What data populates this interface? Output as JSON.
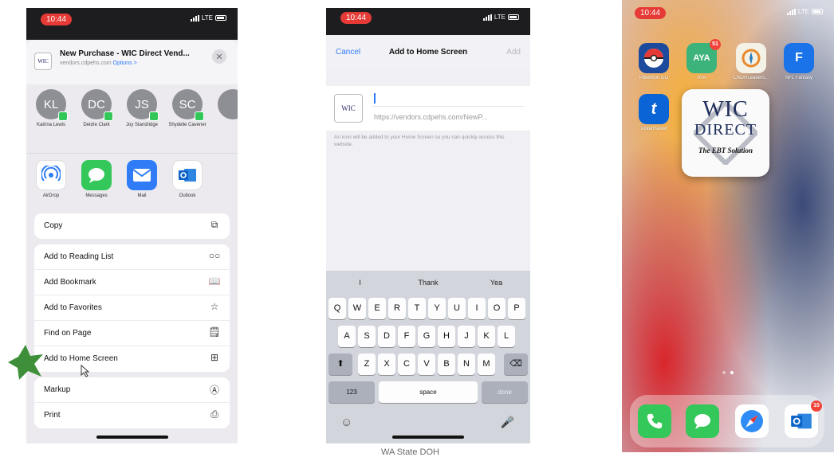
{
  "status": {
    "time": "10:44",
    "network": "LTE"
  },
  "share_sheet": {
    "title": "New Purchase - WIC Direct Vend...",
    "subtitle": "vendors.cdpehs.com",
    "options_label": "Options >",
    "close_icon": "close-icon",
    "contacts": [
      {
        "initials": "KL",
        "name": "Katrina Lewis"
      },
      {
        "initials": "DC",
        "name": "Deidre Clark"
      },
      {
        "initials": "JS",
        "name": "Joy Standridge"
      },
      {
        "initials": "SC",
        "name": "Shydelle Cavener"
      }
    ],
    "apps": [
      {
        "label": "AirDrop",
        "icon": "airdrop-icon",
        "color": "#ffffff"
      },
      {
        "label": "Messages",
        "icon": "messages-icon",
        "color": "#34c759"
      },
      {
        "label": "Mail",
        "icon": "mail-icon",
        "color": "#2f7cf6"
      },
      {
        "label": "Outlook",
        "icon": "outlook-icon",
        "color": "#0b63c7"
      }
    ],
    "actions_group1": [
      {
        "label": "Copy",
        "icon": "copy-icon"
      }
    ],
    "actions_group2": [
      {
        "label": "Add to Reading List",
        "icon": "glasses-icon"
      },
      {
        "label": "Add Bookmark",
        "icon": "book-icon"
      },
      {
        "label": "Add to Favorites",
        "icon": "star-icon"
      },
      {
        "label": "Find on Page",
        "icon": "find-icon"
      },
      {
        "label": "Add to Home Screen",
        "icon": "plus-square-icon"
      }
    ],
    "actions_group3": [
      {
        "label": "Markup",
        "icon": "markup-icon"
      },
      {
        "label": "Print",
        "icon": "print-icon"
      }
    ]
  },
  "add_home": {
    "cancel": "Cancel",
    "title": "Add to Home Screen",
    "add": "Add",
    "url": "https://vendors.cdpehs.com/NewP...",
    "hint": "An icon will be added to your Home Screen so you can quickly access this website.",
    "suggestions": [
      "I",
      "Thank",
      "Yea"
    ],
    "row1": [
      "Q",
      "W",
      "E",
      "R",
      "T",
      "Y",
      "U",
      "I",
      "O",
      "P"
    ],
    "row2": [
      "A",
      "S",
      "D",
      "F",
      "G",
      "H",
      "J",
      "K",
      "L"
    ],
    "row3": [
      "Z",
      "X",
      "C",
      "V",
      "B",
      "N",
      "M"
    ],
    "key_123": "123",
    "key_space": "space",
    "key_done": "done"
  },
  "home_screen": {
    "apps": [
      {
        "label": "Pokémon GO",
        "icon": "pokeball-icon",
        "color": "#1c4a9c"
      },
      {
        "label": "AYA",
        "icon": "aya-icon",
        "color": "#3bb37a",
        "badge": "51"
      },
      {
        "label": "CNDHLeaders...",
        "icon": "compass-icon",
        "color": "#f4f1e6"
      },
      {
        "label": "NFL Fantasy",
        "icon": "nfl-fantasy-icon",
        "color": "#1a73e8"
      },
      {
        "label": "Ticketmaster",
        "icon": "ticketmaster-icon",
        "color": "#0a64d6"
      }
    ],
    "wic": {
      "line1": "WIC",
      "line2": "DIRECT",
      "line3": "The EBT Solution"
    },
    "dock": [
      {
        "icon": "phone-icon",
        "color": "#34c759"
      },
      {
        "icon": "messages-icon",
        "color": "#34c759"
      },
      {
        "icon": "safari-icon",
        "color": "#2f8cf6"
      },
      {
        "icon": "outlook-icon",
        "color": "#0b63c7",
        "badge": "10"
      }
    ]
  },
  "watermark": "WA State DOH",
  "highlight_color": "#3f8f3a"
}
